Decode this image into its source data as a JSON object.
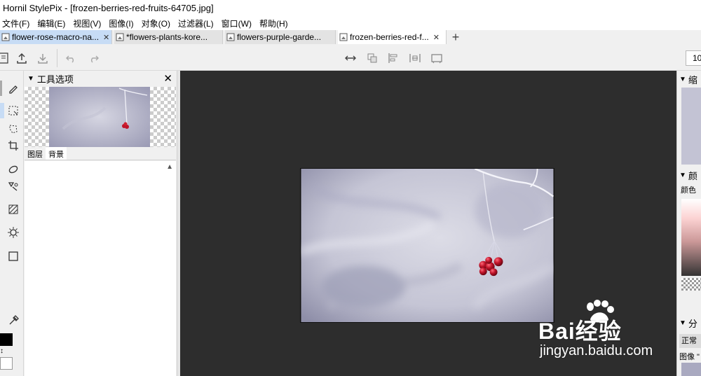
{
  "window": {
    "title": "Hornil StylePix - [frozen-berries-red-fruits-64705.jpg]"
  },
  "menu": [
    "文件(F)",
    "编辑(E)",
    "视图(V)",
    "图像(I)",
    "对象(O)",
    "过滤器(L)",
    "窗口(W)",
    "帮助(H)"
  ],
  "tabs": [
    {
      "label": "flower-rose-macro-na...",
      "close": "✕"
    },
    {
      "label": "*flowers-plants-kore...",
      "close": ""
    },
    {
      "label": "flowers-purple-garde...",
      "close": ""
    },
    {
      "label": "frozen-berries-red-f...",
      "close": "✕"
    }
  ],
  "tab_add": "+",
  "toolbar": {
    "zoom_value": "10"
  },
  "tool_options": {
    "title": "工具选项",
    "close": "✕"
  },
  "layers": {
    "tab_layers": "图层",
    "tab_background": "背景"
  },
  "right_panel": {
    "navigator_title": "缩",
    "color_title": "颜",
    "color_label": "颜色",
    "layers_title": "分",
    "blend_mode": "正常",
    "layer_name": "图像 \""
  },
  "watermark": {
    "brand": "Bai经验",
    "url": "jingyan.baidu.com"
  },
  "colors": {
    "accent": "#c7dcf5",
    "canvas_bg": "#2d2d2d",
    "berry": "#c0142a"
  }
}
